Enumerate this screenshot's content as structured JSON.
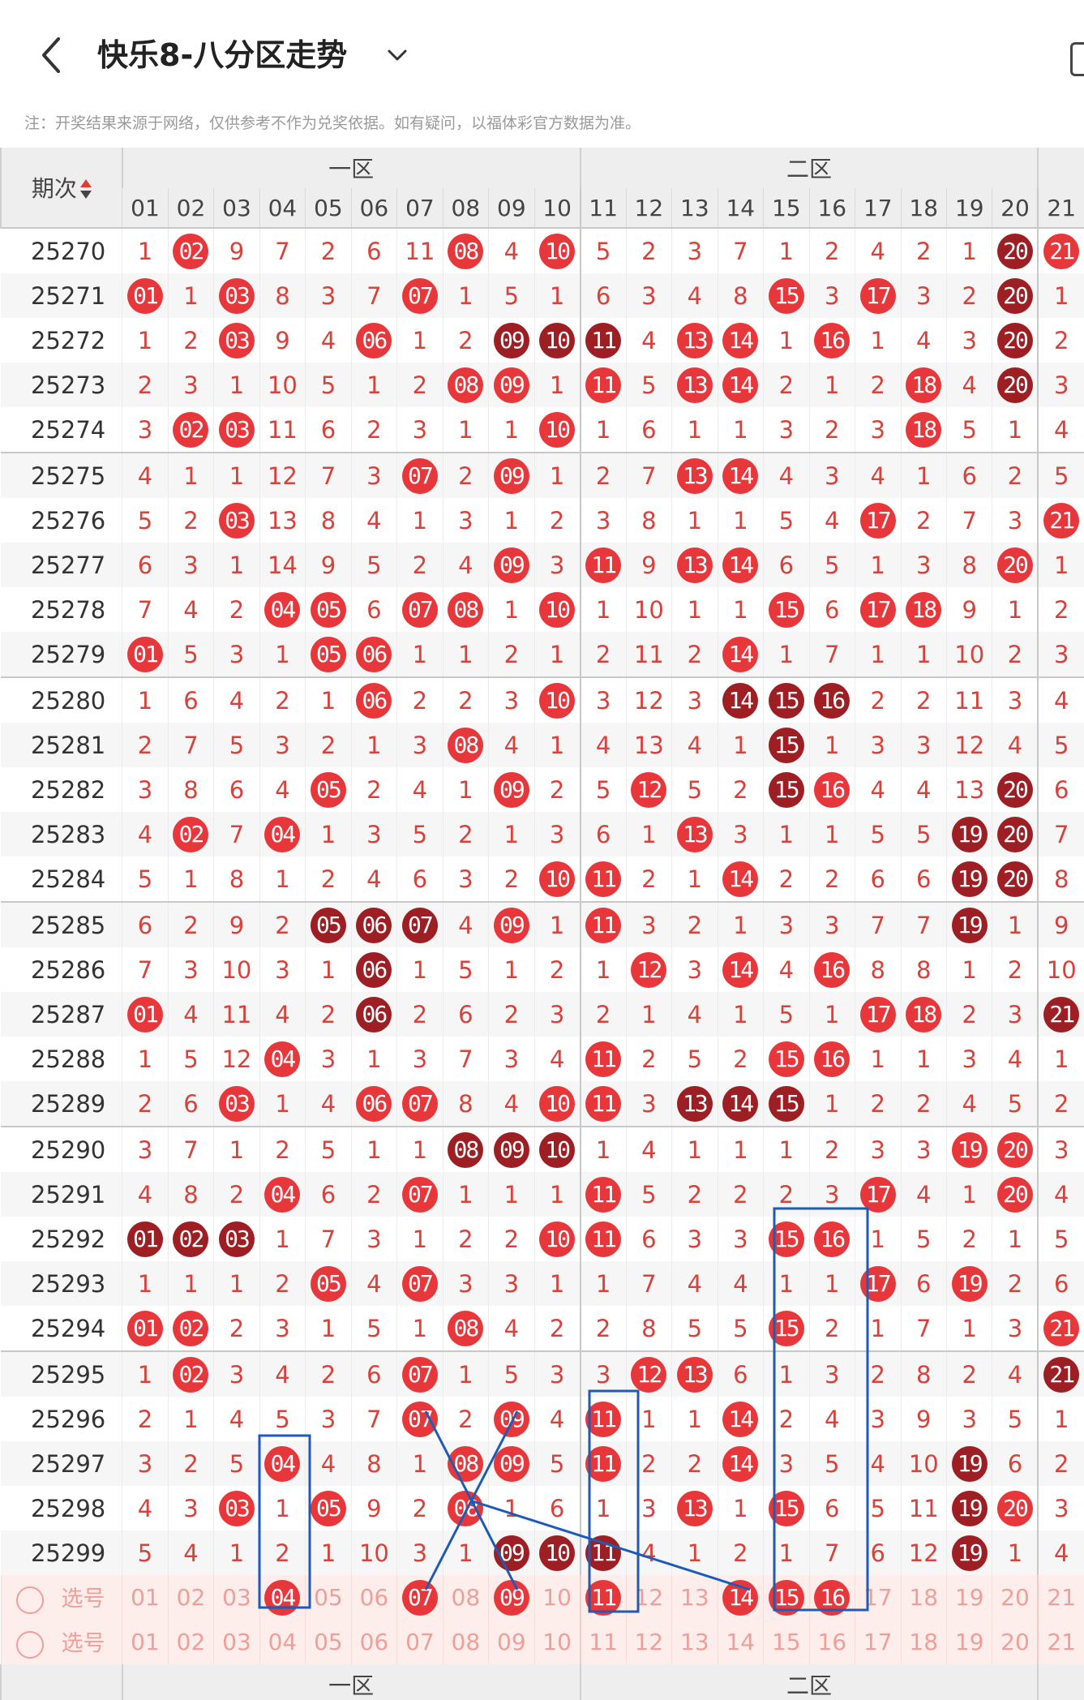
{
  "header": {
    "title": "快乐8-八分区走势",
    "notice": "注：开奖结果来源于网络，仅供参考不作为兑奖依据。如有疑问，以福体彩官方数据为准。"
  },
  "table": {
    "period_header": "期次",
    "zones": [
      "一区",
      "二区"
    ],
    "next_zone": "",
    "columns": [
      "01",
      "02",
      "03",
      "04",
      "05",
      "06",
      "07",
      "08",
      "09",
      "10",
      "11",
      "12",
      "13",
      "14",
      "15",
      "16",
      "17",
      "18",
      "19",
      "20",
      "21"
    ],
    "rows": [
      {
        "period": "25270",
        "cells": [
          "1",
          "r02",
          "9",
          "7",
          "2",
          "6",
          "11",
          "r08",
          "4",
          "r10",
          "5",
          "2",
          "3",
          "7",
          "1",
          "2",
          "4",
          "2",
          "1",
          "d20",
          "r21"
        ]
      },
      {
        "period": "25271",
        "cells": [
          "r01",
          "1",
          "r03",
          "8",
          "3",
          "7",
          "r07",
          "1",
          "5",
          "1",
          "6",
          "3",
          "4",
          "8",
          "r15",
          "3",
          "r17",
          "3",
          "2",
          "d20",
          "1"
        ]
      },
      {
        "period": "25272",
        "cells": [
          "1",
          "2",
          "r03",
          "9",
          "4",
          "r06",
          "1",
          "2",
          "d09",
          "d10",
          "d11",
          "4",
          "r13",
          "r14",
          "1",
          "r16",
          "1",
          "4",
          "3",
          "d20",
          "2"
        ]
      },
      {
        "period": "25273",
        "cells": [
          "2",
          "3",
          "1",
          "10",
          "5",
          "1",
          "2",
          "r08",
          "r09",
          "1",
          "r11",
          "5",
          "r13",
          "r14",
          "2",
          "1",
          "2",
          "r18",
          "4",
          "d20",
          "3"
        ]
      },
      {
        "period": "25274",
        "cells": [
          "3",
          "r02",
          "r03",
          "11",
          "6",
          "2",
          "3",
          "1",
          "1",
          "r10",
          "1",
          "6",
          "1",
          "1",
          "3",
          "2",
          "3",
          "r18",
          "5",
          "1",
          "4"
        ]
      },
      {
        "period": "25275",
        "cells": [
          "4",
          "1",
          "1",
          "12",
          "7",
          "3",
          "r07",
          "2",
          "r09",
          "1",
          "2",
          "7",
          "r13",
          "r14",
          "4",
          "3",
          "4",
          "1",
          "6",
          "2",
          "5"
        ]
      },
      {
        "period": "25276",
        "cells": [
          "5",
          "2",
          "r03",
          "13",
          "8",
          "4",
          "1",
          "3",
          "1",
          "2",
          "3",
          "8",
          "1",
          "1",
          "5",
          "4",
          "r17",
          "2",
          "7",
          "3",
          "r21"
        ]
      },
      {
        "period": "25277",
        "cells": [
          "6",
          "3",
          "1",
          "14",
          "9",
          "5",
          "2",
          "4",
          "r09",
          "3",
          "r11",
          "9",
          "r13",
          "r14",
          "6",
          "5",
          "1",
          "3",
          "8",
          "r20",
          "1"
        ]
      },
      {
        "period": "25278",
        "cells": [
          "7",
          "4",
          "2",
          "r04",
          "r05",
          "6",
          "r07",
          "r08",
          "1",
          "r10",
          "1",
          "10",
          "1",
          "1",
          "r15",
          "6",
          "r17",
          "r18",
          "9",
          "1",
          "2"
        ]
      },
      {
        "period": "25279",
        "cells": [
          "r01",
          "5",
          "3",
          "1",
          "r05",
          "r06",
          "1",
          "1",
          "2",
          "1",
          "2",
          "11",
          "2",
          "r14",
          "1",
          "7",
          "1",
          "1",
          "10",
          "2",
          "3"
        ]
      },
      {
        "period": "25280",
        "cells": [
          "1",
          "6",
          "4",
          "2",
          "1",
          "r06",
          "2",
          "2",
          "3",
          "r10",
          "3",
          "12",
          "3",
          "d14",
          "d15",
          "d16",
          "2",
          "2",
          "11",
          "3",
          "4"
        ]
      },
      {
        "period": "25281",
        "cells": [
          "2",
          "7",
          "5",
          "3",
          "2",
          "1",
          "3",
          "r08",
          "4",
          "1",
          "4",
          "13",
          "4",
          "1",
          "d15",
          "1",
          "3",
          "3",
          "12",
          "4",
          "5"
        ]
      },
      {
        "period": "25282",
        "cells": [
          "3",
          "8",
          "6",
          "4",
          "r05",
          "2",
          "4",
          "1",
          "r09",
          "2",
          "5",
          "r12",
          "5",
          "2",
          "d15",
          "r16",
          "4",
          "4",
          "13",
          "d20",
          "6"
        ]
      },
      {
        "period": "25283",
        "cells": [
          "4",
          "r02",
          "7",
          "r04",
          "1",
          "3",
          "5",
          "2",
          "1",
          "3",
          "6",
          "1",
          "r13",
          "3",
          "1",
          "1",
          "5",
          "5",
          "d19",
          "d20",
          "7"
        ]
      },
      {
        "period": "25284",
        "cells": [
          "5",
          "1",
          "8",
          "1",
          "2",
          "4",
          "6",
          "3",
          "2",
          "r10",
          "r11",
          "2",
          "1",
          "r14",
          "2",
          "2",
          "6",
          "6",
          "d19",
          "d20",
          "8"
        ]
      },
      {
        "period": "25285",
        "cells": [
          "6",
          "2",
          "9",
          "2",
          "d05",
          "d06",
          "d07",
          "4",
          "r09",
          "1",
          "r11",
          "3",
          "2",
          "1",
          "3",
          "3",
          "7",
          "7",
          "d19",
          "1",
          "9"
        ]
      },
      {
        "period": "25286",
        "cells": [
          "7",
          "3",
          "10",
          "3",
          "1",
          "d06",
          "1",
          "5",
          "1",
          "2",
          "1",
          "r12",
          "3",
          "r14",
          "4",
          "r16",
          "8",
          "8",
          "1",
          "2",
          "10"
        ]
      },
      {
        "period": "25287",
        "cells": [
          "r01",
          "4",
          "11",
          "4",
          "2",
          "d06",
          "2",
          "6",
          "2",
          "3",
          "2",
          "1",
          "4",
          "1",
          "5",
          "1",
          "r17",
          "r18",
          "2",
          "3",
          "d21"
        ]
      },
      {
        "period": "25288",
        "cells": [
          "1",
          "5",
          "12",
          "r04",
          "3",
          "1",
          "3",
          "7",
          "3",
          "4",
          "r11",
          "2",
          "5",
          "2",
          "r15",
          "r16",
          "1",
          "1",
          "3",
          "4",
          "1"
        ]
      },
      {
        "period": "25289",
        "cells": [
          "2",
          "6",
          "r03",
          "1",
          "4",
          "r06",
          "r07",
          "8",
          "4",
          "r10",
          "r11",
          "3",
          "d13",
          "d14",
          "d15",
          "1",
          "2",
          "2",
          "4",
          "5",
          "2"
        ]
      },
      {
        "period": "25290",
        "cells": [
          "3",
          "7",
          "1",
          "2",
          "5",
          "1",
          "1",
          "d08",
          "d09",
          "d10",
          "1",
          "4",
          "1",
          "1",
          "1",
          "2",
          "3",
          "3",
          "r19",
          "r20",
          "3"
        ]
      },
      {
        "period": "25291",
        "cells": [
          "4",
          "8",
          "2",
          "r04",
          "6",
          "2",
          "r07",
          "1",
          "1",
          "1",
          "r11",
          "5",
          "2",
          "2",
          "2",
          "3",
          "r17",
          "4",
          "1",
          "r20",
          "4"
        ]
      },
      {
        "period": "25292",
        "cells": [
          "d01",
          "d02",
          "d03",
          "1",
          "7",
          "3",
          "1",
          "2",
          "2",
          "r10",
          "r11",
          "6",
          "3",
          "3",
          "r15",
          "r16",
          "1",
          "5",
          "2",
          "1",
          "5"
        ]
      },
      {
        "period": "25293",
        "cells": [
          "1",
          "1",
          "1",
          "2",
          "r05",
          "4",
          "r07",
          "3",
          "3",
          "1",
          "1",
          "7",
          "4",
          "4",
          "1",
          "1",
          "r17",
          "6",
          "r19",
          "2",
          "6"
        ]
      },
      {
        "period": "25294",
        "cells": [
          "r01",
          "r02",
          "2",
          "3",
          "1",
          "5",
          "1",
          "r08",
          "4",
          "2",
          "2",
          "8",
          "5",
          "5",
          "r15",
          "2",
          "1",
          "7",
          "1",
          "3",
          "r21"
        ]
      },
      {
        "period": "25295",
        "cells": [
          "1",
          "r02",
          "3",
          "4",
          "2",
          "6",
          "r07",
          "1",
          "5",
          "3",
          "3",
          "r12",
          "r13",
          "6",
          "1",
          "3",
          "2",
          "8",
          "2",
          "4",
          "d21"
        ]
      },
      {
        "period": "25296",
        "cells": [
          "2",
          "1",
          "4",
          "5",
          "3",
          "7",
          "r07",
          "2",
          "r09",
          "4",
          "r11",
          "1",
          "1",
          "r14",
          "2",
          "4",
          "3",
          "9",
          "3",
          "5",
          "1"
        ]
      },
      {
        "period": "25297",
        "cells": [
          "3",
          "2",
          "5",
          "r04",
          "4",
          "8",
          "1",
          "r08",
          "r09",
          "5",
          "r11",
          "2",
          "2",
          "r14",
          "3",
          "5",
          "4",
          "10",
          "d19",
          "6",
          "2"
        ]
      },
      {
        "period": "25298",
        "cells": [
          "4",
          "3",
          "r03",
          "1",
          "r05",
          "9",
          "2",
          "r08",
          "1",
          "6",
          "1",
          "3",
          "r13",
          "1",
          "r15",
          "6",
          "5",
          "11",
          "d19",
          "r20",
          "3"
        ]
      },
      {
        "period": "25299",
        "cells": [
          "5",
          "4",
          "1",
          "2",
          "1",
          "10",
          "3",
          "1",
          "d09",
          "d10",
          "d11",
          "4",
          "1",
          "2",
          "1",
          "7",
          "6",
          "12",
          "d19",
          "1",
          "4"
        ]
      }
    ],
    "pick_rows": [
      {
        "label": "选号",
        "cells": [
          "01",
          "02",
          "03",
          "r04",
          "05",
          "06",
          "r07",
          "08",
          "r09",
          "10",
          "r11",
          "12",
          "13",
          "r14",
          "r15",
          "r16",
          "17",
          "18",
          "19",
          "20",
          "21"
        ]
      },
      {
        "label": "选号",
        "cells": [
          "01",
          "02",
          "03",
          "04",
          "05",
          "06",
          "07",
          "08",
          "09",
          "10",
          "11",
          "12",
          "13",
          "14",
          "15",
          "16",
          "17",
          "18",
          "19",
          "20",
          "21"
        ]
      }
    ]
  },
  "colors": {
    "ball_red": "#e8373a",
    "ball_dark": "#9e1f23",
    "missing_text": "#d9413a",
    "annotation_blue": "#1e5bb8",
    "pick_row_bg": "#fdeeec"
  }
}
